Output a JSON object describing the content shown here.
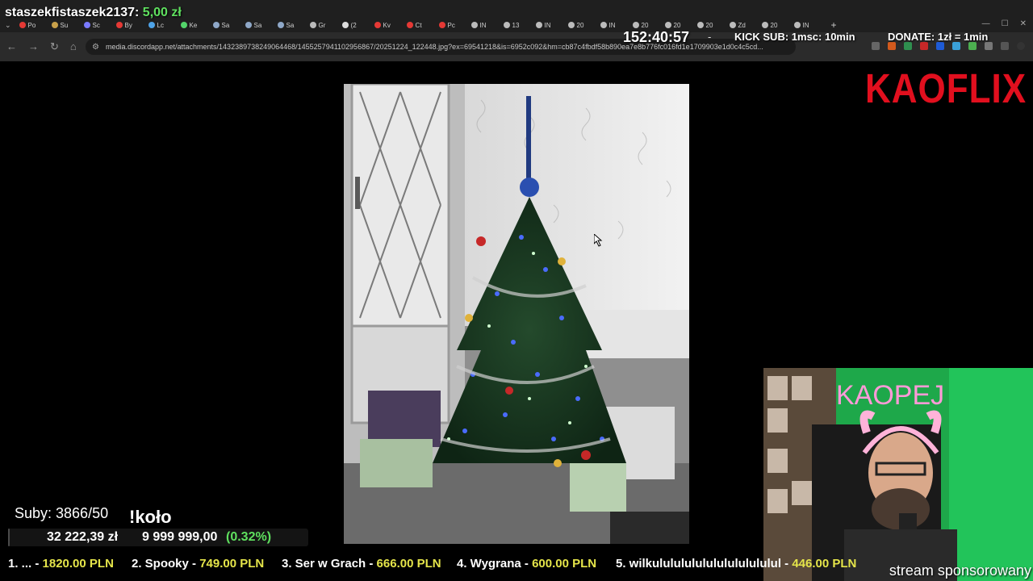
{
  "browser": {
    "tabs": [
      {
        "label": "Po",
        "color": "#e53935"
      },
      {
        "label": "Su",
        "color": "#c8a04a"
      },
      {
        "label": "Sc",
        "color": "#7a7aff"
      },
      {
        "label": "By",
        "color": "#e53935"
      },
      {
        "label": "Lc",
        "color": "#4ea3e8"
      },
      {
        "label": "Ke",
        "color": "#53d46a"
      },
      {
        "label": "Sa",
        "color": "#8fa8c8"
      },
      {
        "label": "Sa",
        "color": "#8fa8c8"
      },
      {
        "label": "Sa",
        "color": "#8fa8c8"
      },
      {
        "label": "Gr",
        "color": "#bbbbbb"
      },
      {
        "label": "(2",
        "color": "#dddddd"
      },
      {
        "label": "Kv",
        "color": "#e53935"
      },
      {
        "label": "Ct",
        "color": "#e53935"
      },
      {
        "label": "Pc",
        "color": "#e53935"
      },
      {
        "label": "IN",
        "color": "#bbbbbb"
      },
      {
        "label": "13",
        "color": "#bbbbbb"
      },
      {
        "label": "IN",
        "color": "#bbbbbb"
      },
      {
        "label": "20",
        "color": "#bbbbbb"
      },
      {
        "label": "IN",
        "color": "#bbbbbb"
      },
      {
        "label": "20",
        "color": "#bbbbbb"
      },
      {
        "label": "20",
        "color": "#bbbbbb"
      },
      {
        "label": "20",
        "color": "#bbbbbb"
      },
      {
        "label": "Zd",
        "color": "#bbbbbb"
      },
      {
        "label": "20",
        "color": "#bbbbbb"
      },
      {
        "label": "IN",
        "color": "#bbbbbb"
      }
    ],
    "url": "media.discordapp.net/attachments/1432389738249064468/1455257941102956867/20251224_122448.jpg?ex=69541218&is=6952c092&hm=cb87c4fbdf58b890ea7e8b776fc016fd1e1709903e1d0c4c5cd..."
  },
  "overlay": {
    "donor_name": "staszekfistaszek2137:",
    "donor_amount": "5,00 zł",
    "timer": "152:40:57",
    "separator": "-",
    "kick_sub": "KICK SUB: 1msc: 10min",
    "donate": "DONATE: 1zł = 1min",
    "logo": "KAOFLIX",
    "subs": "Suby: 3866/50",
    "kolo": "!koło",
    "goal_current": "32 222,39 zł",
    "goal_target": "9 999 999,00",
    "goal_percent": "(0.32%)",
    "goal_fraction": 0.0032,
    "sponsor": "stream sponsorowany",
    "ticker": [
      {
        "label": "1. ... - ",
        "value": "1820.00 PLN"
      },
      {
        "label": "2. Spooky - ",
        "value": "749.00 PLN"
      },
      {
        "label": "3. Ser w Grach - ",
        "value": "666.00 PLN"
      },
      {
        "label": "4. Wygrana - ",
        "value": "600.00 PLN"
      },
      {
        "label": "5. wilkulululululululululululul - ",
        "value": "446.00 PLN"
      }
    ]
  }
}
